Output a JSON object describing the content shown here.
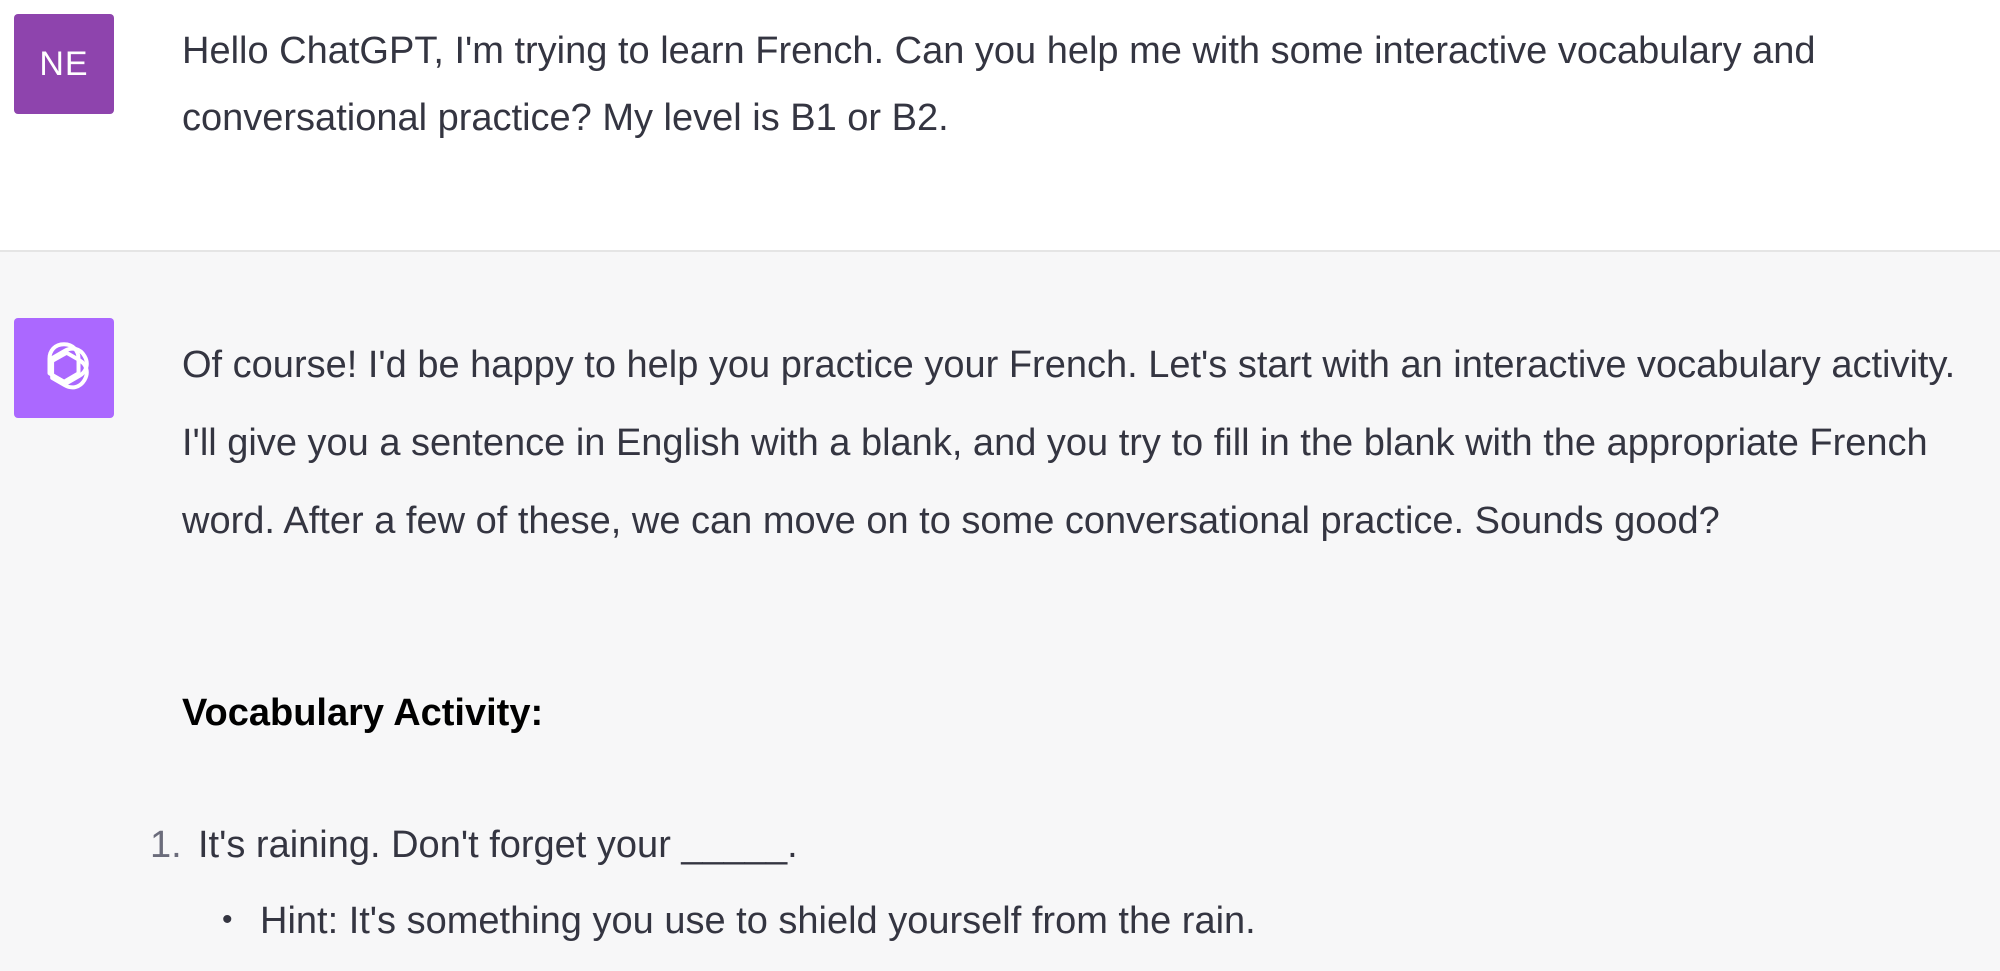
{
  "user_message": {
    "avatar_initials": "NE",
    "avatar_color": "#8e44ad",
    "text": "Hello ChatGPT, I'm trying to learn French. Can you help me with some interactive vocabulary and conversational practice? My level is B1 or B2."
  },
  "assistant_message": {
    "avatar_icon": "openai-logo-icon",
    "avatar_color": "#ab68ff",
    "intro": "Of course! I'd be happy to help you practice your French. Let's start with an interactive vocabulary activity. I'll give you a sentence in English with a blank, and you try to fill in the blank with the appropriate French word. After a few of these, we can move on to some conversational practice. Sounds good?",
    "heading": "Vocabulary Activity:",
    "items": [
      {
        "number": "1.",
        "text": "It's raining. Don't forget your _____.",
        "hint": "Hint: It's something you use to shield yourself from the rain."
      }
    ]
  }
}
